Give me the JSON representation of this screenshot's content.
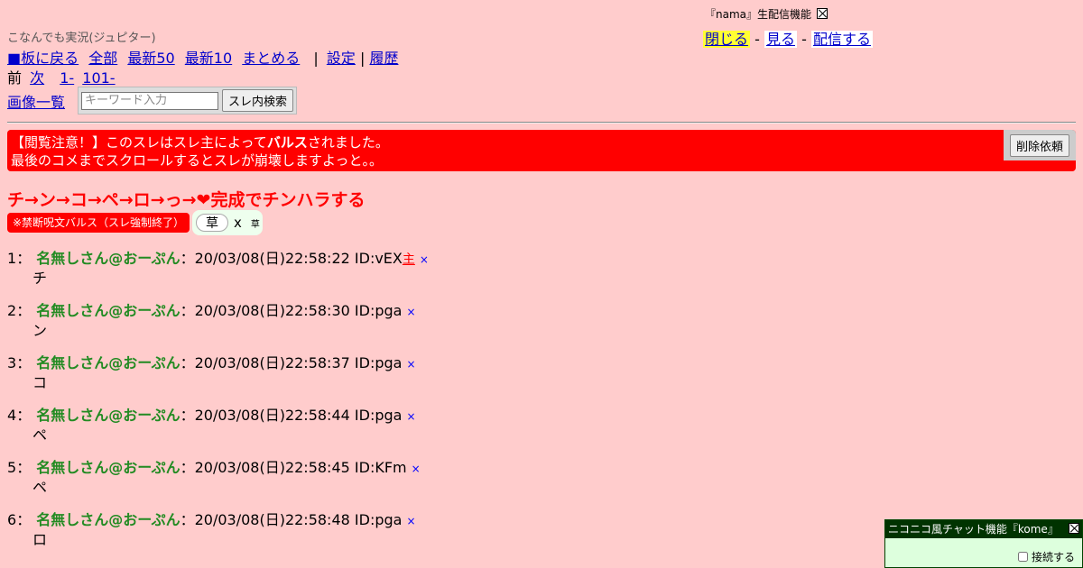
{
  "board": {
    "name": "こなんでも実況(ジュピター)"
  },
  "nav": {
    "back": "■板に戻る",
    "all": "全部",
    "latest50": "最新50",
    "latest10": "最新10",
    "summarize": "まとめる",
    "sep": "|",
    "settings": "設定",
    "sep2": "|",
    "history": "履歴"
  },
  "paging": {
    "prev": "前",
    "next": "次",
    "range1": "1-",
    "range2": "101-"
  },
  "tools": {
    "images": "画像一覧",
    "search_placeholder": "キーワード入力",
    "search_button": "スレ内検索"
  },
  "nama": {
    "title": "『nama』生配信機能",
    "close": "閉じる",
    "dash1": "-",
    "watch": "見る",
    "dash2": "-",
    "broadcast": "配信する"
  },
  "warning": {
    "line1_prefix": "【閲覧注意！】このスレはスレ主によって",
    "line1_bold": "バルス",
    "line1_suffix": "されました。",
    "line2": "最後のコメまでスクロールするとスレが崩壊しますよっと。。",
    "delete_button": "削除依頼"
  },
  "thread": {
    "title_prefix": "チ→ン→コ→ペ→ロ→っ→",
    "title_heart": "❤",
    "title_suffix": "完成でチンハラする",
    "badge": "※禁断呪文バルス（スレ強制終了）",
    "kusa_button": "草",
    "kusa_x": "x",
    "kusa_count": "草"
  },
  "posts": [
    {
      "num": "1",
      "sep": "：",
      "name": "名無しさん@おーぷん",
      "colon": "：",
      "date": "20/03/08(日)22:58:22",
      "id": "ID:vEX",
      "owner": "主",
      "del": "×",
      "body": "チ"
    },
    {
      "num": "2",
      "sep": "：",
      "name": "名無しさん@おーぷん",
      "colon": "：",
      "date": "20/03/08(日)22:58:30",
      "id": "ID:pga",
      "owner": "",
      "del": "×",
      "body": "ン"
    },
    {
      "num": "3",
      "sep": "：",
      "name": "名無しさん@おーぷん",
      "colon": "：",
      "date": "20/03/08(日)22:58:37",
      "id": "ID:pga",
      "owner": "",
      "del": "×",
      "body": "コ"
    },
    {
      "num": "4",
      "sep": "：",
      "name": "名無しさん@おーぷん",
      "colon": "：",
      "date": "20/03/08(日)22:58:44",
      "id": "ID:pga",
      "owner": "",
      "del": "×",
      "body": "ペ"
    },
    {
      "num": "5",
      "sep": "：",
      "name": "名無しさん@おーぷん",
      "colon": "：",
      "date": "20/03/08(日)22:58:45",
      "id": "ID:KFm",
      "owner": "",
      "del": "×",
      "body": "ペ"
    },
    {
      "num": "6",
      "sep": "：",
      "name": "名無しさん@おーぷん",
      "colon": "：",
      "date": "20/03/08(日)22:58:48",
      "id": "ID:pga",
      "owner": "",
      "del": "×",
      "body": "ロ"
    }
  ],
  "chat": {
    "title": "ニコニコ風チャット機能『kome』",
    "connect": "接続する"
  },
  "icons": {
    "close": "close-icon"
  }
}
